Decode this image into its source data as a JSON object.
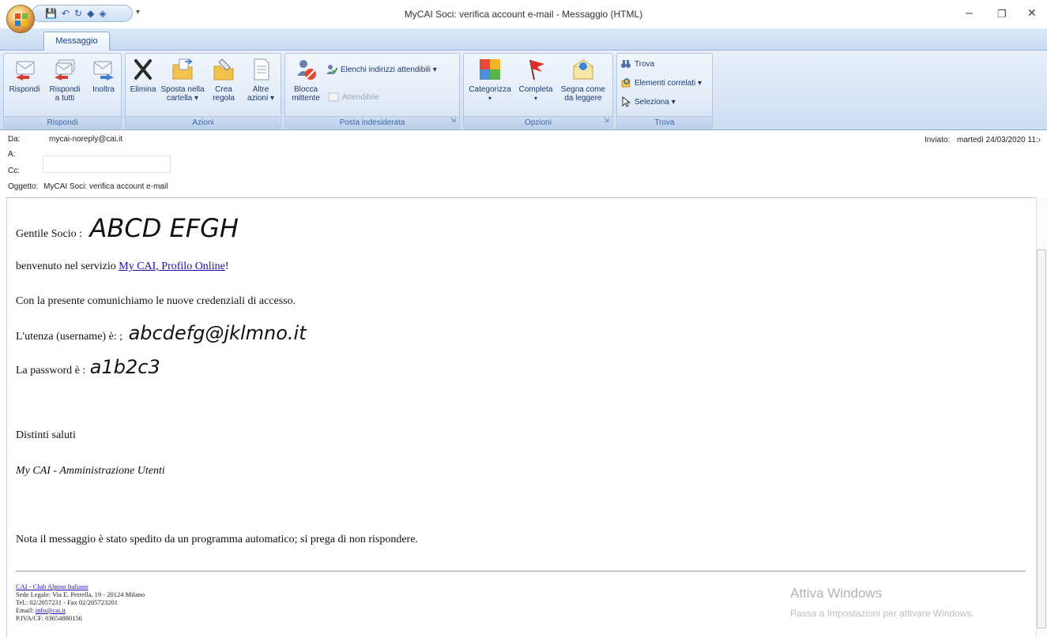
{
  "window": {
    "title": "MyCAI Soci: verifica account e-mail - Messaggio (HTML)",
    "minimize": "–",
    "restore": "❐",
    "close": "✕"
  },
  "tabs": {
    "active": "Messaggio"
  },
  "ribbon": {
    "groups": {
      "rispondi": {
        "label": "Rispondi",
        "buttons": {
          "reply": "Rispondi",
          "reply_all_1": "Rispondi",
          "reply_all_2": "a tutti",
          "forward": "Inoltra"
        }
      },
      "azioni": {
        "label": "Azioni",
        "buttons": {
          "delete": "Elimina",
          "move_1": "Sposta nella",
          "move_2": "cartella ▾",
          "rule_1": "Crea",
          "rule_2": "regola",
          "other_1": "Altre",
          "other_2": "azioni ▾"
        }
      },
      "posta": {
        "label": "Posta indesiderata",
        "buttons": {
          "block_1": "Blocca",
          "block_2": "mittente",
          "safe_lists": "Elenchi indirizzi attendibili ▾",
          "safe": "Attendibile"
        }
      },
      "opzioni": {
        "label": "Opzioni",
        "buttons": {
          "categorize": "Categorizza",
          "follow_up": "Completa",
          "mark_1": "Segna come",
          "mark_2": "da leggere"
        }
      },
      "trova": {
        "label": "Trova",
        "buttons": {
          "find": "Trova",
          "related": "Elementi correlati ▾",
          "select": "Seleziona ▾"
        }
      }
    }
  },
  "header": {
    "from_label": "Da:",
    "from_value": "mycai-noreply@cai.it",
    "to_label": "A:",
    "cc_label": "Cc:",
    "subject_label": "Oggetto:",
    "subject_value": "MyCAI Soci: verifica account e-mail",
    "sent_label": "Inviato:",
    "sent_value": "martedì 24/03/2020 11:›"
  },
  "message": {
    "greeting": "Gentile Socio :",
    "name": "ABCD EFGH",
    "welcome_prefix": "benvenuto nel servizio ",
    "welcome_link": "My CAI, Profilo Online",
    "welcome_suffix": "!",
    "intro": "Con la presente comunichiamo le nuove credenziali di accesso.",
    "username_label": "L'utenza (username) è: ;",
    "username_value": "abcdefg@jklmno.it",
    "password_label": "La password è :",
    "password_value": "a1b2c3",
    "regards": "Distinti saluti",
    "signature": "My CAI - Amministrazione Utenti",
    "note": "Nota il messaggio è stato spedito da un programma automatico; si prega di non rispondere."
  },
  "footer": {
    "org_link": "CAI - Club Alpino Italiano",
    "address": "Sede Legale: Via E. Petrella, 19 - 20124 Milano",
    "phone": "Tel.: 02/2057231 - Fax 02/205723201",
    "email_label": "Email: ",
    "email_link": "info@cai.it",
    "vat": "P.IVA/CF: 03654880156"
  },
  "watermark": {
    "line1": "Attiva Windows",
    "line2": "Passa a Impostazioni per attivare Windows."
  },
  "colors": {
    "ribbon_bg": "#d8e5f5",
    "accent": "#15428b",
    "link": "#1a0dab"
  }
}
